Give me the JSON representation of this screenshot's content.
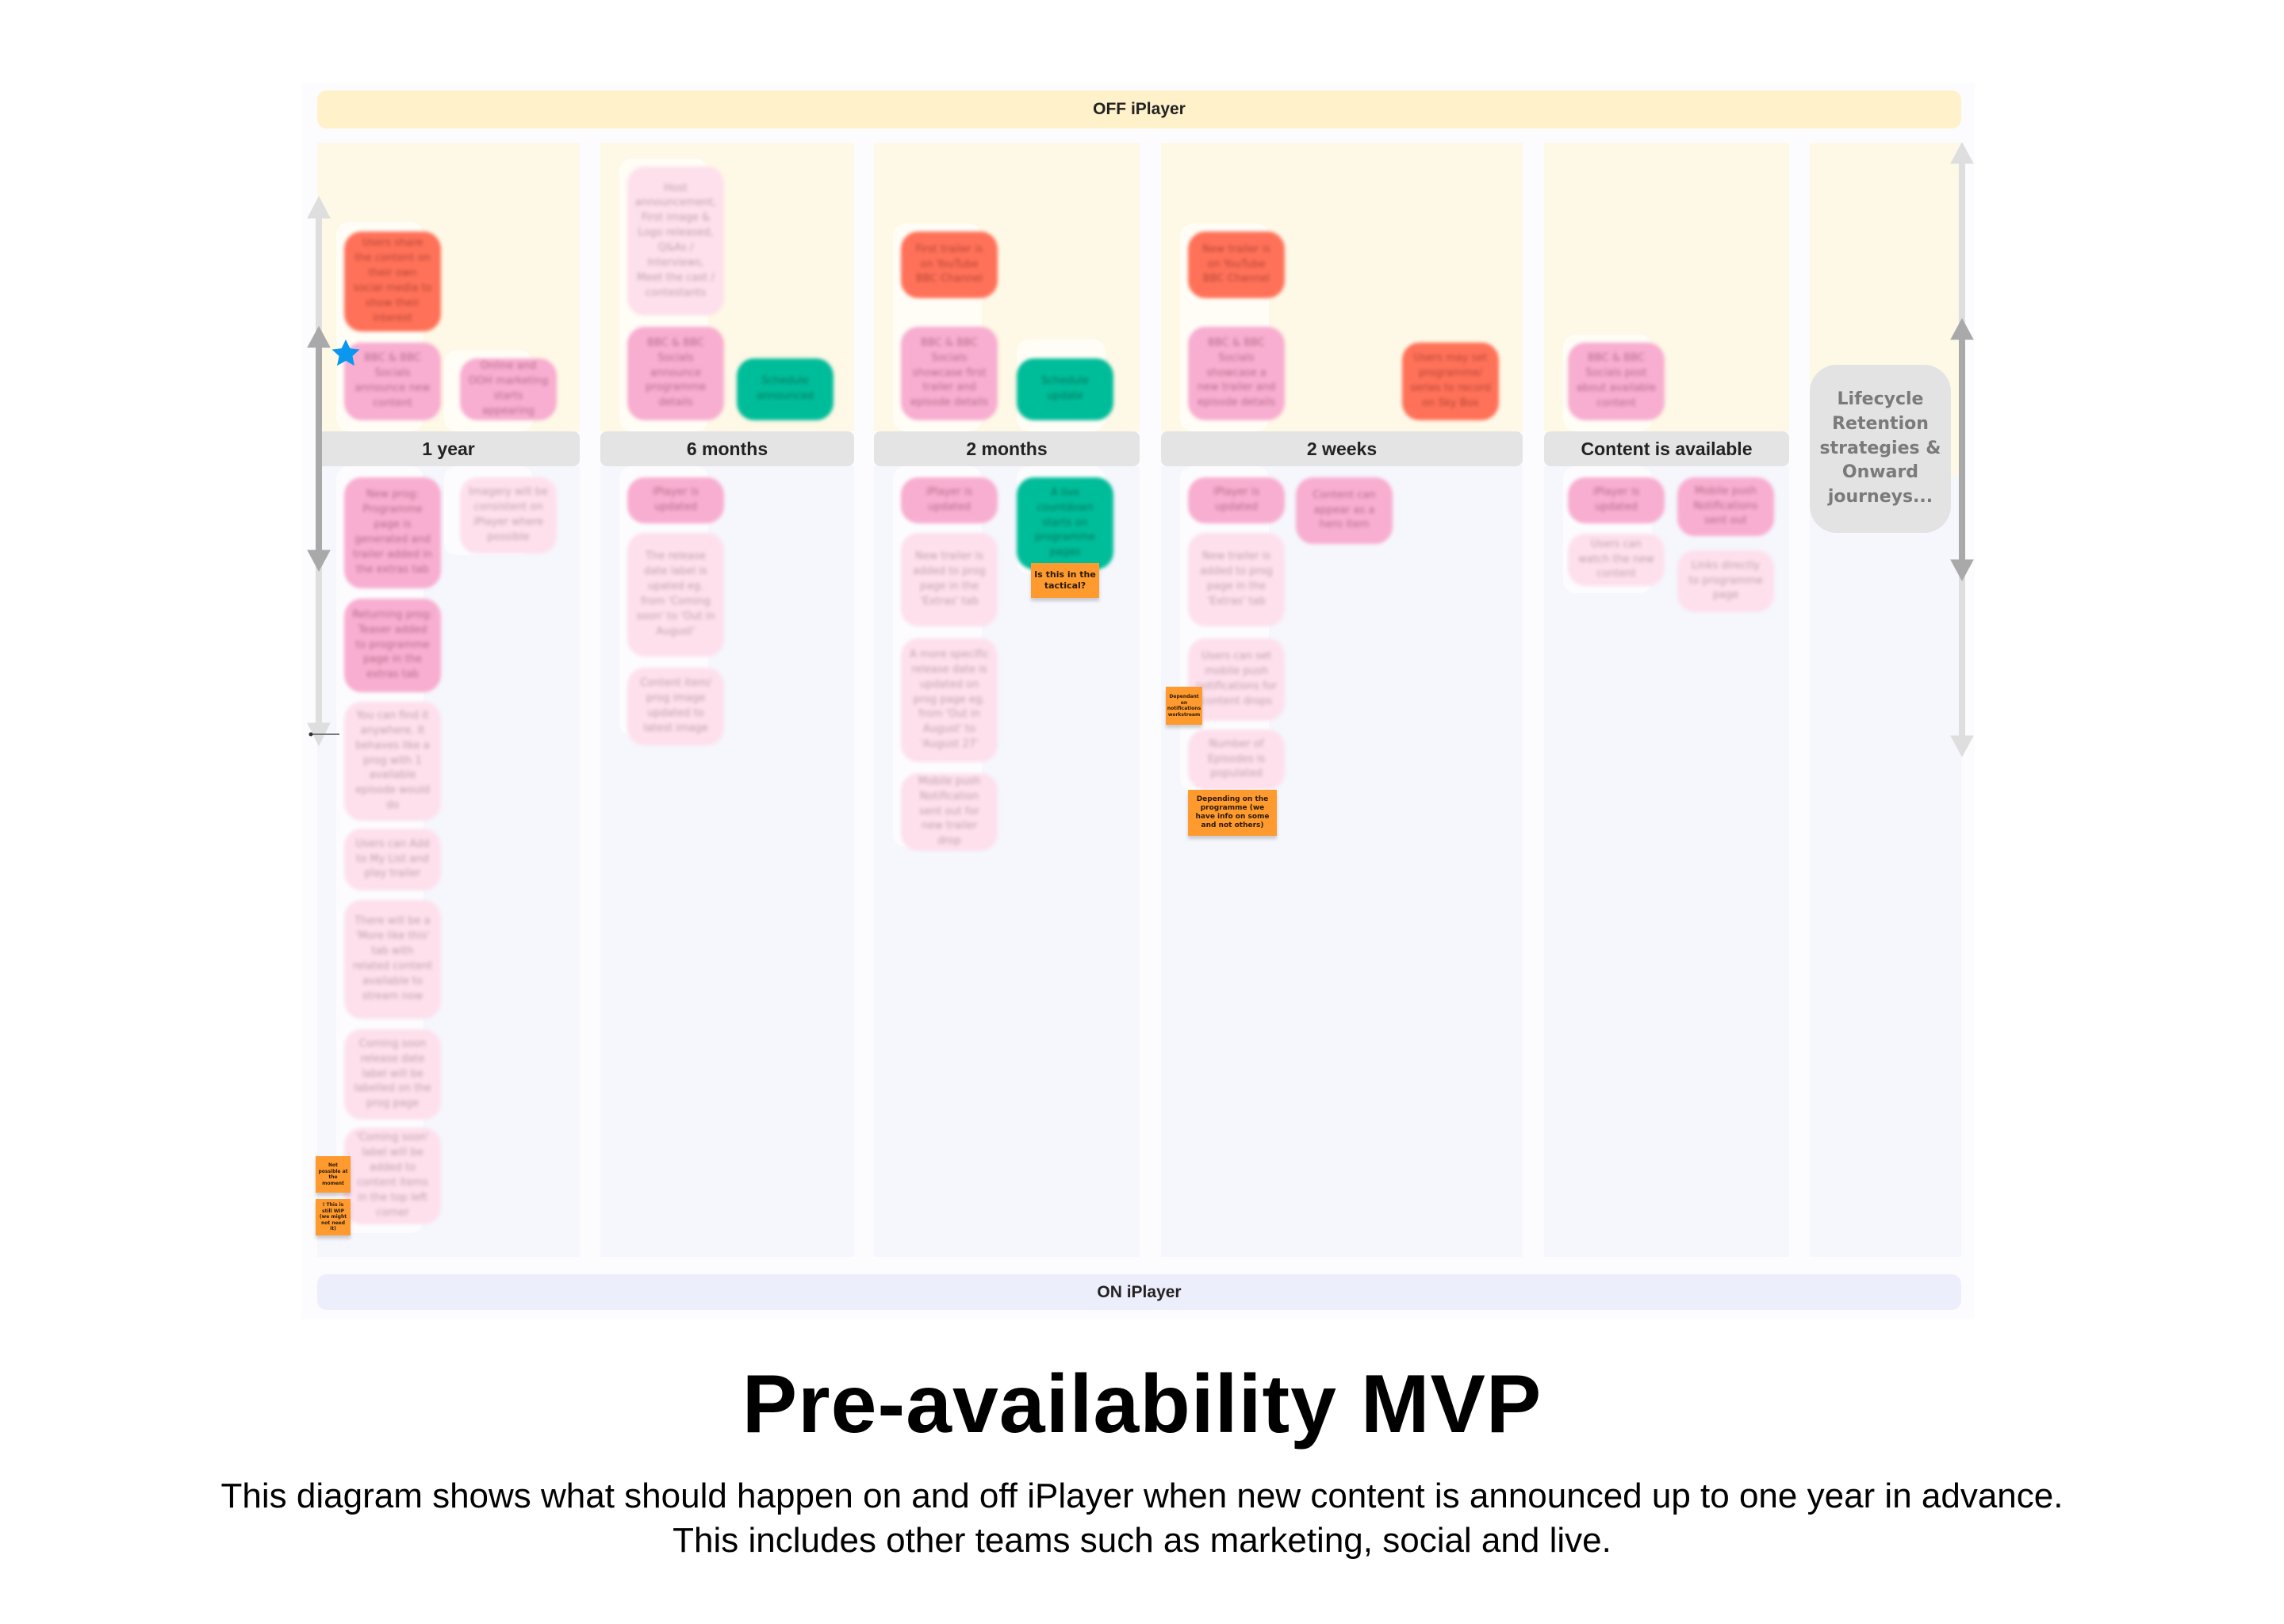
{
  "board": {
    "off_label": "OFF iPlayer",
    "on_label": "ON iPlayer",
    "lifecycle_label": "Lifecycle Retention strategies & Onward journeys...",
    "columns": [
      {
        "header": "1 year",
        "off": [
          {
            "text": "Users share the content on their own social media to show their interest",
            "color": "red"
          },
          {
            "text": "BBC & BBC Socials announce new content",
            "color": "pink",
            "starred": true
          },
          {
            "text": "Online and OOH marketing starts appearing",
            "color": "pink"
          }
        ],
        "on": [
          {
            "text": "New prog: Programme page is generated and trailer added in the extras tab",
            "color": "pink"
          },
          {
            "text": "Imagery will be consistent on iPlayer where possible",
            "color": "light"
          },
          {
            "text": "Returning prog: Teaser added to programme page in the extras tab",
            "color": "pink"
          },
          {
            "text": "You can find it anywhere. It behaves like a prog with 1 available episode would do",
            "color": "light"
          },
          {
            "text": "Users can Add to My List and play trailer",
            "color": "light"
          },
          {
            "text": "There will be a 'More like this' tab with related content available to stream now",
            "color": "light"
          },
          {
            "text": "Coming soon release date label will be labelled on the prog page",
            "color": "light"
          },
          {
            "text": "'Coming soon' label will be added to content items in the top left corner",
            "color": "light"
          }
        ],
        "notes": [
          "Not possible at the moment",
          "! This is still WIP (we might not need it)"
        ]
      },
      {
        "header": "6 months",
        "off": [
          {
            "text": "Host announcement, First image & Logo released, Q&As / Interviews, Meet the cast / contestants",
            "color": "light"
          },
          {
            "text": "BBC & BBC Socials announce programme details",
            "color": "pink"
          },
          {
            "text": "Schedule announced",
            "color": "teal"
          }
        ],
        "on": [
          {
            "text": "iPlayer is updated",
            "color": "pink"
          },
          {
            "text": "The release date label is upated eg. from 'Coming soon' to 'Out in August'",
            "color": "light"
          },
          {
            "text": "Content item/ prog image updated to latest image",
            "color": "light"
          }
        ],
        "notes": []
      },
      {
        "header": "2 months",
        "off": [
          {
            "text": "First trailer is on YouTube BBC Channel",
            "color": "red"
          },
          {
            "text": "BBC & BBC Socials showcase first trailer and episode details",
            "color": "pink"
          },
          {
            "text": "Schedule update",
            "color": "teal"
          }
        ],
        "on": [
          {
            "text": "iPlayer is updated",
            "color": "pink"
          },
          {
            "text": "A live countdown starts on programme pages",
            "color": "teal"
          },
          {
            "text": "New trailer is added to prog page in the 'Extras' tab",
            "color": "light"
          },
          {
            "text": "A more specific release date is updated on prog page eg. from 'Out in August' to 'August 27'",
            "color": "light"
          },
          {
            "text": "Mobile push Notification sent out for new trailer drop",
            "color": "light"
          }
        ],
        "notes": [
          "Is this in the tactical?"
        ]
      },
      {
        "header": "2 weeks",
        "off": [
          {
            "text": "New trailer is on YouTube BBC Channel",
            "color": "red"
          },
          {
            "text": "BBC & BBC Socials showcase a new trailer and episode details",
            "color": "pink"
          },
          {
            "text": "Users may set programme/ series to record on Sky Box",
            "color": "red"
          }
        ],
        "on": [
          {
            "text": "iPlayer is updated",
            "color": "pink"
          },
          {
            "text": "Content can appear as a hero item",
            "color": "pink"
          },
          {
            "text": "New trailer is added to prog page in the 'Extras' tab",
            "color": "light"
          },
          {
            "text": "Users can set mobile push notifications for content drops",
            "color": "light"
          },
          {
            "text": "Number of Episodes is populated",
            "color": "light"
          }
        ],
        "notes": [
          "Dependant on notifications workstream",
          "Depending on the programme (we have info on some and not others)"
        ]
      },
      {
        "header": "Content is available",
        "off": [
          {
            "text": "BBC & BBC Socials post about available content",
            "color": "pink"
          }
        ],
        "on": [
          {
            "text": "iPlayer is updated",
            "color": "pink"
          },
          {
            "text": "Mobile push Notifications sent out",
            "color": "pink"
          },
          {
            "text": "Users can watch the new content",
            "color": "light"
          },
          {
            "text": "Links directly to programme page",
            "color": "light"
          }
        ],
        "notes": []
      }
    ]
  },
  "colors": {
    "off_band": "#fff1c9",
    "on_band": "#edeefc",
    "red_card": "#ff7259",
    "pink_card": "#f8aed0",
    "light_card": "#fde0ec",
    "teal_card": "#00bd99",
    "note": "#ff9a2e",
    "star": "#0a97f0"
  },
  "footer": {
    "title": "Pre-availability MVP",
    "line1": "This diagram shows what should happen on and off iPlayer when new content is announced up to one year in advance.",
    "line2": "This includes other teams such as marketing, social and live."
  }
}
